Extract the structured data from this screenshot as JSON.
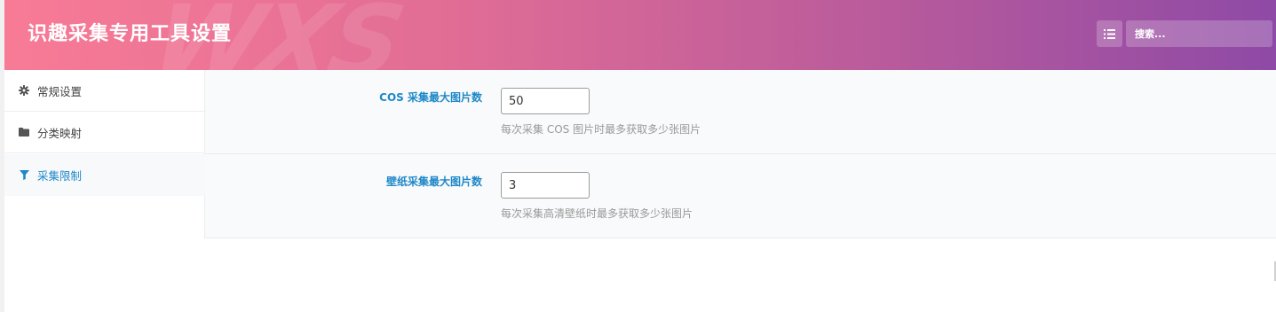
{
  "header": {
    "title": "识趣采集专用工具设置",
    "watermark": "WXS",
    "menu_icon": "list-icon",
    "search_placeholder": "搜索..."
  },
  "sidebar": {
    "items": [
      {
        "label": "常规设置",
        "icon": "gear-icon",
        "active": false
      },
      {
        "label": "分类映射",
        "icon": "folder-icon",
        "active": false
      },
      {
        "label": "采集限制",
        "icon": "filter-icon",
        "active": true
      }
    ]
  },
  "settings": [
    {
      "label": "COS 采集最大图片数",
      "value": "50",
      "help": "每次采集 COS 图片时最多获取多少张图片"
    },
    {
      "label": "壁纸采集最大图片数",
      "value": "3",
      "help": "每次采集高清壁纸时最多获取多少张图片"
    }
  ],
  "colors": {
    "accent": "#1e88c8",
    "header_gradient_start": "#f87b96",
    "header_gradient_end": "#8e4aa6"
  }
}
